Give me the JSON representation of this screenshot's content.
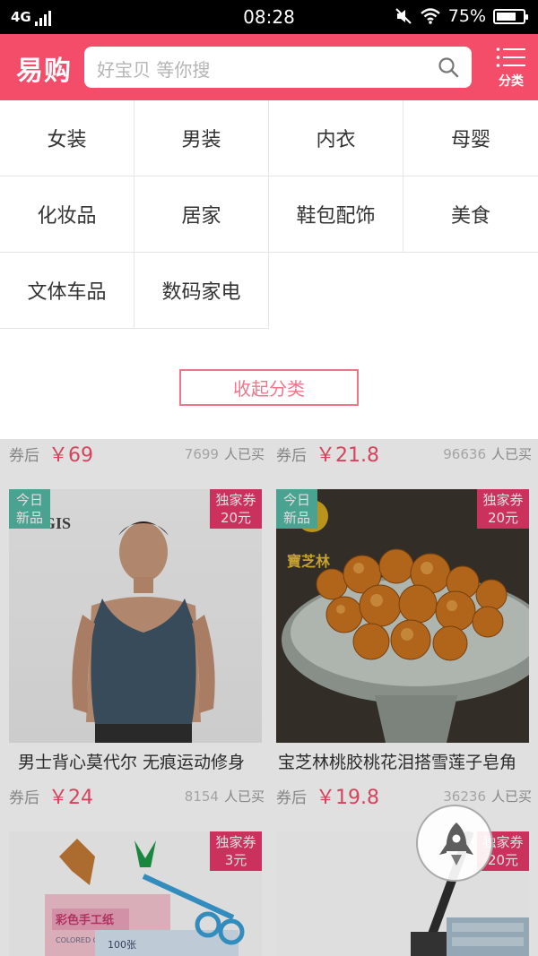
{
  "status_bar": {
    "network": "4G",
    "time": "08:28",
    "battery_text": "75%",
    "battery_level": 0.75
  },
  "header": {
    "logo": "易购",
    "search_placeholder": "好宝贝 等你搜",
    "menu_label": "分类"
  },
  "categories": {
    "items": [
      "女装",
      "男装",
      "内衣",
      "母婴",
      "化妆品",
      "居家",
      "鞋包配饰",
      "美食",
      "文体车品",
      "数码家电"
    ],
    "collapse_label": "收起分类"
  },
  "feed": {
    "price_prefix": "券后",
    "sold_suffix": "人已买",
    "badge_new_line1": "今日",
    "badge_new_line2": "新品",
    "badge_coupon_line1": "独家券",
    "top_row": [
      {
        "price": "￥69",
        "sold": "7699"
      },
      {
        "price": "￥21.8",
        "sold": "96636"
      }
    ],
    "products": [
      {
        "title": "男士背心莫代尔 无痕运动修身",
        "price": "￥24",
        "sold": "8154",
        "coupon": "20元",
        "brand_text": "SINGIS"
      },
      {
        "title": "宝芝林桃胶桃花泪搭雪莲子皂角",
        "price": "￥19.8",
        "sold": "36236",
        "coupon": "20元",
        "brand_text": "寶芝林"
      }
    ],
    "bottom_row": [
      {
        "coupon": "3元",
        "paper_label": "彩色手工纸",
        "paper_label_sub": "COLORED ORIGAMI PAPER",
        "count_label": "100张"
      },
      {
        "coupon": "20元"
      }
    ]
  },
  "colors": {
    "brand": "#f44d6a",
    "price": "#f44d6a",
    "new_badge": "#55b9a5",
    "coupon_badge": "#e8386a"
  }
}
